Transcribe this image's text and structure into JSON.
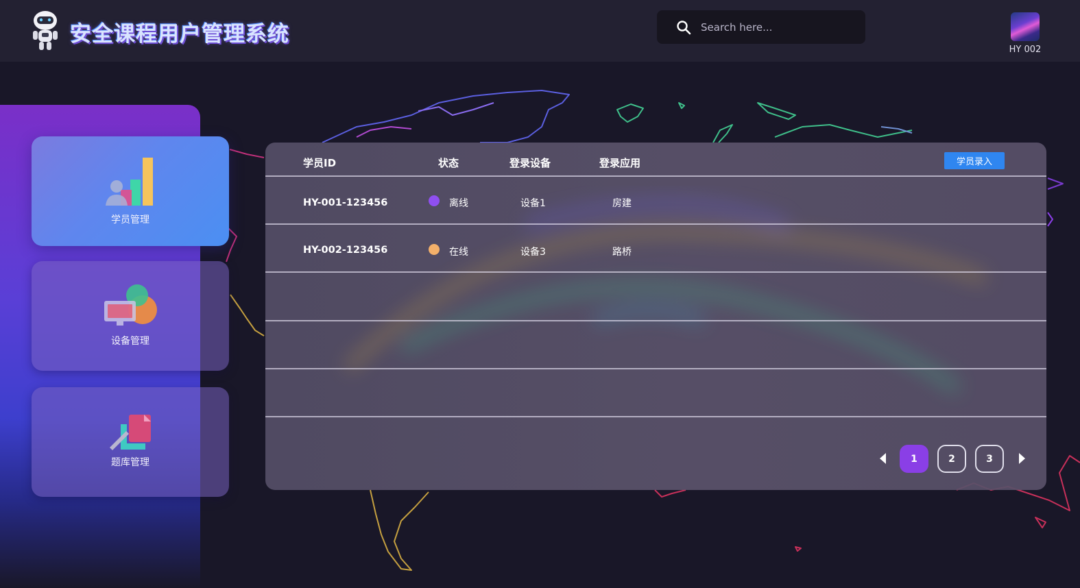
{
  "header": {
    "title": "安全课程用户管理系统",
    "search_placeholder": "Search here...",
    "user_name": "HY 002"
  },
  "sidebar": {
    "items": [
      {
        "label": "学员管理",
        "icon": "bar-chart-user-icon",
        "active": true
      },
      {
        "label": "设备管理",
        "icon": "monitor-device-icon",
        "active": false
      },
      {
        "label": "题库管理",
        "icon": "question-bank-icon",
        "active": false
      }
    ]
  },
  "table": {
    "columns": [
      "学员ID",
      "状态",
      "登录设备",
      "登录应用"
    ],
    "add_button": "学员录入",
    "rows": [
      {
        "id": "HY-001-123456",
        "status": "离线",
        "status_color": "#8f4ff0",
        "device": "设备1",
        "app": "房建"
      },
      {
        "id": "HY-002-123456",
        "status": "在线",
        "status_color": "#f3b06a",
        "device": "设备3",
        "app": "路桥"
      }
    ]
  },
  "pagination": {
    "pages": [
      "1",
      "2",
      "3"
    ],
    "current": "1",
    "accent_color": "#8a3fe6"
  }
}
